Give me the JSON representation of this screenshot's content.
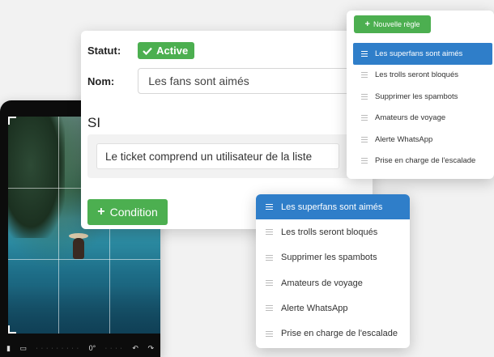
{
  "phone": {
    "toolbar_left": "▮",
    "toolbar_dots": "· · · · · · · · ·",
    "toolbar_angle": "0°",
    "toolbar_undo": "↶",
    "toolbar_redo": "↷"
  },
  "rule": {
    "status_label": "Statut:",
    "status_value": "Active",
    "name_label": "Nom:",
    "name_value": "Les fans sont aimés",
    "if_label": "SI",
    "condition_text": "Le ticket comprend un utilisateur de la liste",
    "add_condition_label": "Condition"
  },
  "rules_panel": {
    "new_rule_label": "Nouvelle règle",
    "items": [
      "Les superfans sont aimés",
      "Les trolls seront bloqués",
      "Supprimer les spambots",
      "Amateurs de voyage",
      "Alerte WhatsApp",
      "Prise en charge de l'escalade"
    ],
    "active_index": 0
  },
  "rules_panel_2": {
    "items": [
      "Les superfans sont aimés",
      "Les trolls seront bloqués",
      "Supprimer les spambots",
      "Amateurs de voyage",
      "Alerte WhatsApp",
      "Prise en charge de l'escalade"
    ],
    "active_index": 0
  },
  "colors": {
    "accent_green": "#4caf50",
    "accent_blue": "#2f7ec9",
    "background": "#f2f2f2"
  }
}
